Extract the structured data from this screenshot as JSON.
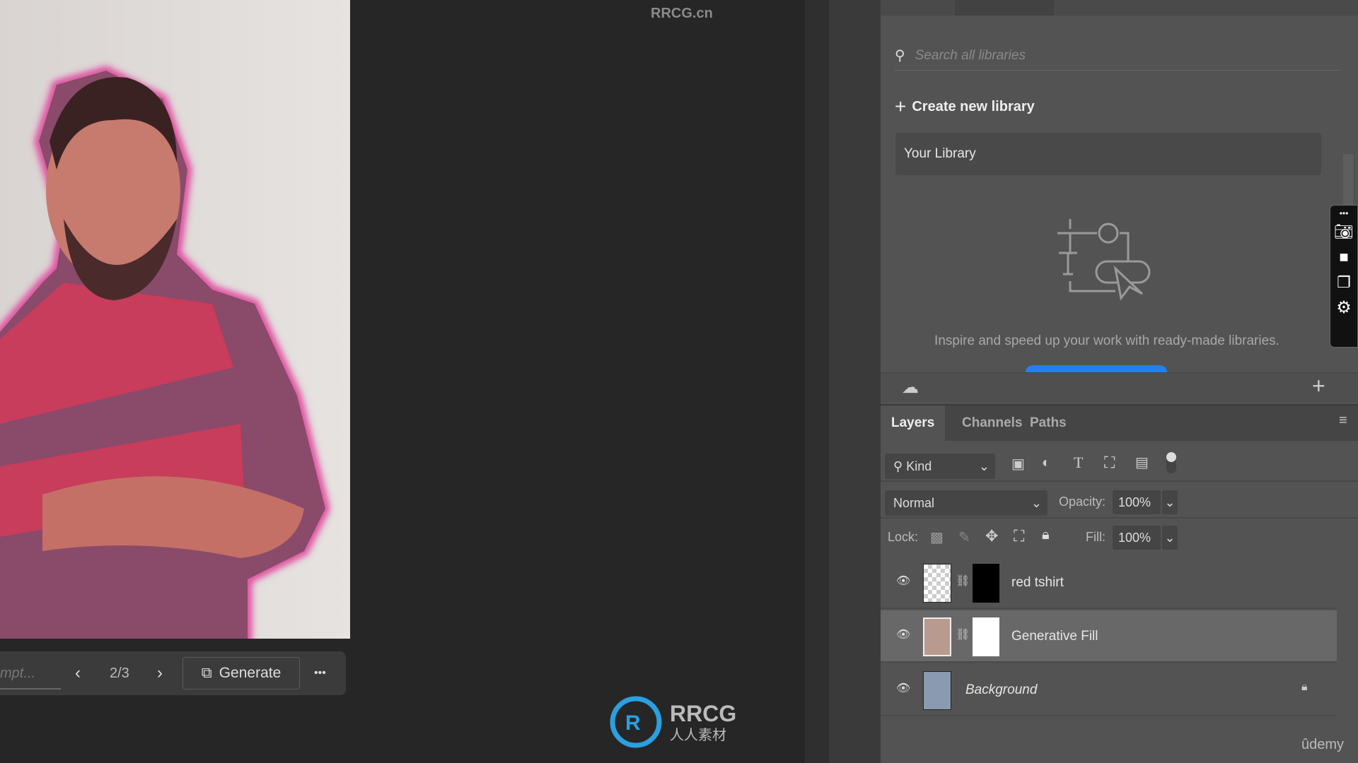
{
  "watermark_top": "RRCG.cn",
  "watermark_logo": "RRCG 人人素材",
  "taskbar": {
    "prompt_placeholder": "mpt...",
    "variation": "2/3",
    "generate_label": "Generate",
    "more_label": "•••"
  },
  "libraries": {
    "search_placeholder": "Search all libraries",
    "create_label": "Create new library",
    "library_name": "Your Library",
    "inspire_text": "Inspire and speed up your work with ready-made libraries."
  },
  "layers_panel": {
    "tabs": [
      "Layers",
      "Channels",
      "Paths"
    ],
    "active_tab": "Layers",
    "filter_kind": "Kind",
    "blend_mode": "Normal",
    "opacity_label": "Opacity:",
    "opacity": "100%",
    "lock_label": "Lock:",
    "fill_label": "Fill:",
    "fill": "100%",
    "layers": [
      {
        "name": "red tshirt",
        "visible": true
      },
      {
        "name": "Generative Fill",
        "visible": true,
        "selected": true
      },
      {
        "name": "Background",
        "visible": true,
        "locked": true
      }
    ]
  },
  "udemy": "ûdemy",
  "colors": {
    "accent": "#2680eb",
    "selection_glow": "#e0409a"
  }
}
